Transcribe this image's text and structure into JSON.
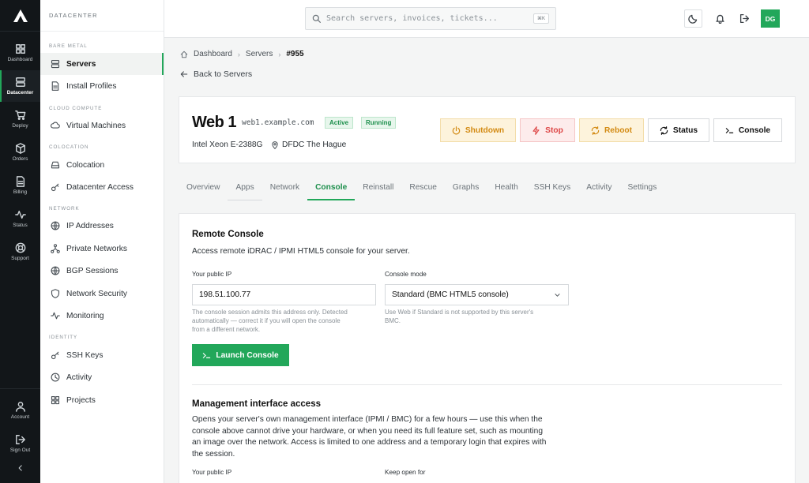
{
  "rail": {
    "items": [
      {
        "label": "Dashboard",
        "icon": "grid-icon"
      },
      {
        "label": "Datacenter",
        "icon": "server-icon"
      },
      {
        "label": "Deploy",
        "icon": "cart-icon"
      },
      {
        "label": "Orders",
        "icon": "box-icon"
      },
      {
        "label": "Billing",
        "icon": "file-icon"
      },
      {
        "label": "Status",
        "icon": "pulse-icon"
      },
      {
        "label": "Support",
        "icon": "lifebuoy-icon"
      },
      {
        "label": "Account",
        "icon": "user-icon"
      },
      {
        "label": "Sign Out",
        "icon": "sign-out-icon"
      }
    ],
    "active": "Datacenter"
  },
  "sidebar": {
    "title": "DATACENTER",
    "sections": [
      "BARE METAL",
      "CLOUD COMPUTE",
      "COLOCATION",
      "NETWORK",
      "IDENTITY"
    ],
    "items": [
      {
        "label": "Servers",
        "icon": "server-icon"
      },
      {
        "label": "Install Profiles",
        "icon": "file-icon"
      },
      {
        "label": "Virtual Machines",
        "icon": "cloud-icon"
      },
      {
        "label": "Colocation",
        "icon": "drive-icon"
      },
      {
        "label": "Datacenter Access",
        "icon": "key-icon"
      },
      {
        "label": "IP Addresses",
        "icon": "globe-icon"
      },
      {
        "label": "Private Networks",
        "icon": "network-icon"
      },
      {
        "label": "BGP Sessions",
        "icon": "globe-icon"
      },
      {
        "label": "Network Security",
        "icon": "shield-icon"
      },
      {
        "label": "Monitoring",
        "icon": "pulse-icon"
      },
      {
        "label": "SSH Keys",
        "icon": "key-icon"
      },
      {
        "label": "Activity",
        "icon": "clock-icon"
      },
      {
        "label": "Projects",
        "icon": "grid-icon"
      }
    ],
    "active": "Servers"
  },
  "topbar": {
    "search_placeholder": "Search servers, invoices, tickets...",
    "shortcut": "⌘K",
    "avatar_initials": "DG"
  },
  "breadcrumb": {
    "items": [
      "Dashboard",
      "Servers",
      "#955"
    ]
  },
  "back_link": "Back to Servers",
  "server": {
    "name": "Web 1",
    "hostname": "web1.example.com",
    "badges": [
      "Active",
      "Running"
    ],
    "cpu": "Intel Xeon E-2388G",
    "location": "DFDC The Hague",
    "actions": [
      "Shutdown",
      "Stop",
      "Reboot",
      "Status",
      "Console"
    ]
  },
  "tabs": {
    "items": [
      "Overview",
      "Apps",
      "Network",
      "Console",
      "Reinstall",
      "Rescue",
      "Graphs",
      "Health",
      "SSH Keys",
      "Activity",
      "Settings"
    ],
    "active": "Console"
  },
  "console": {
    "title": "Remote Console",
    "description": "Access remote iDRAC / IPMI HTML5 console for your server.",
    "ip_label": "Your public IP",
    "ip_value": "198.51.100.77",
    "ip_help": [
      "The console session admits this address only. Detected",
      "automatically — correct it if you will open the console",
      "from a different network."
    ],
    "mode_label": "Console mode",
    "mode_value": "Standard (BMC HTML5 console)",
    "mode_help": [
      "Use Web if Standard is not supported by this server's",
      "BMC."
    ],
    "launch_label": "Launch Console"
  },
  "management": {
    "title": "Management interface access",
    "description": [
      "Opens your server's own management interface (IPMI / BMC) for a few hours — use this when the",
      "console above cannot drive your hardware, or when you need its full feature set, such as mounting",
      "an image over the network. Access is limited to one address and a temporary login that expires with",
      "the session."
    ],
    "ip_label": "Your public IP",
    "keep_open_label": "Keep open for"
  }
}
